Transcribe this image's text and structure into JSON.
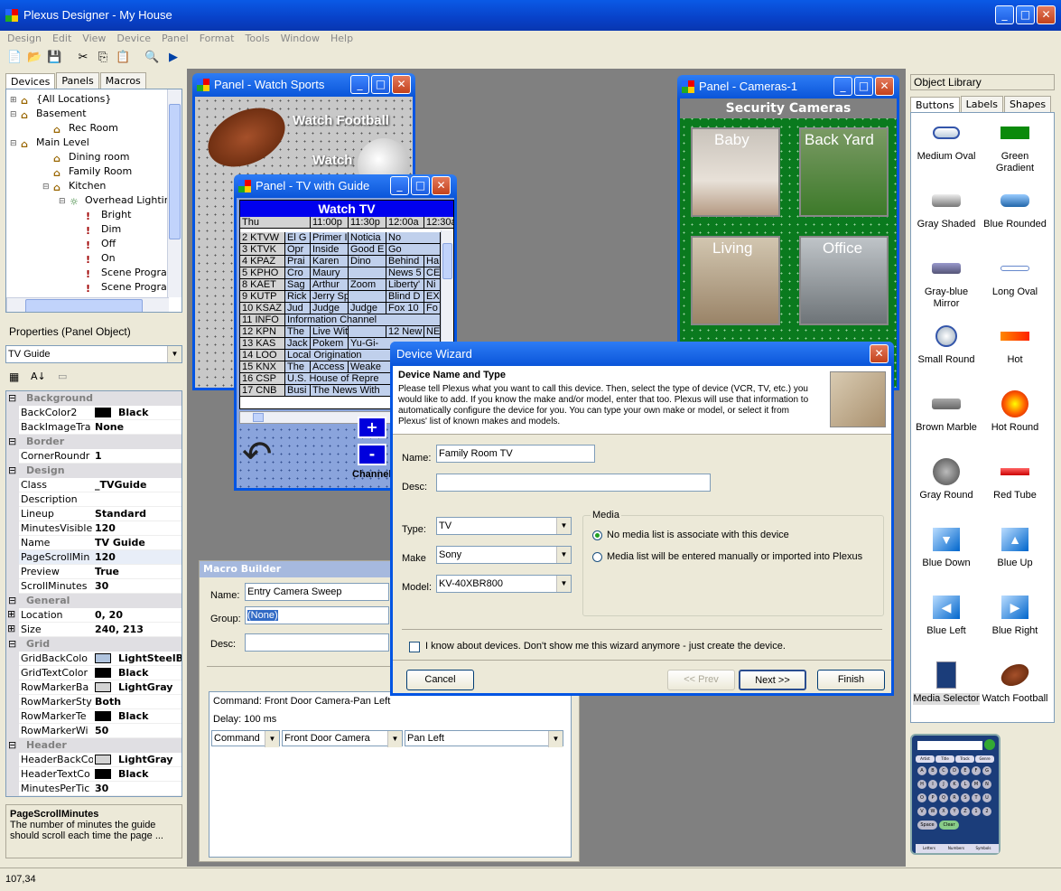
{
  "app": {
    "title": "Plexus Designer - My House"
  },
  "menu": [
    "Design",
    "Edit",
    "View",
    "Device",
    "Panel",
    "Format",
    "Tools",
    "Window",
    "Help"
  ],
  "left_tabs": [
    "Devices",
    "Panels",
    "Macros"
  ],
  "tree": [
    {
      "label": "{All Locations}",
      "depth": 0,
      "icon": "house-icon"
    },
    {
      "label": "Basement",
      "depth": 0,
      "icon": "house-icon"
    },
    {
      "label": "Rec Room",
      "depth": 1,
      "icon": "house-icon"
    },
    {
      "label": "Main Level",
      "depth": 0,
      "icon": "house-icon"
    },
    {
      "label": "Dining room",
      "depth": 1,
      "icon": "house-icon"
    },
    {
      "label": "Family Room",
      "depth": 1,
      "icon": "house-icon"
    },
    {
      "label": "Kitchen",
      "depth": 1,
      "icon": "house-icon"
    },
    {
      "label": "Overhead Lighting",
      "depth": 2,
      "icon": "lamp-icon"
    },
    {
      "label": "Bright",
      "depth": 3,
      "icon": "exclaim-icon"
    },
    {
      "label": "Dim",
      "depth": 3,
      "icon": "exclaim-icon"
    },
    {
      "label": "Off",
      "depth": 3,
      "icon": "exclaim-icon"
    },
    {
      "label": "On",
      "depth": 3,
      "icon": "exclaim-icon"
    },
    {
      "label": "Scene Program",
      "depth": 3,
      "icon": "exclaim-icon"
    },
    {
      "label": "Scene Program",
      "depth": 3,
      "icon": "exclaim-icon"
    }
  ],
  "properties": {
    "header": "Properties (Panel Object)",
    "object": "TV Guide",
    "rows": [
      {
        "cat": "Background"
      },
      {
        "name": "BackColor2",
        "value": "Black",
        "swatch": "#000000"
      },
      {
        "name": "BackImageTra",
        "value": "None"
      },
      {
        "cat": "Border"
      },
      {
        "name": "CornerRoundr",
        "value": "1"
      },
      {
        "cat": "Design"
      },
      {
        "name": "Class",
        "value": "_TVGuide"
      },
      {
        "name": "Description",
        "value": ""
      },
      {
        "name": "Lineup",
        "value": "Standard"
      },
      {
        "name": "MinutesVisible",
        "value": "120"
      },
      {
        "name": "Name",
        "value": "TV Guide"
      },
      {
        "name": "PageScrollMin",
        "value": "120"
      },
      {
        "name": "Preview",
        "value": "True"
      },
      {
        "name": "ScrollMinutes",
        "value": "30"
      },
      {
        "cat": "General"
      },
      {
        "name": "Location",
        "value": "0, 20"
      },
      {
        "name": "Size",
        "value": "240, 213"
      },
      {
        "cat": "Grid"
      },
      {
        "name": "GridBackColo",
        "value": "LightSteelBlue",
        "swatch": "#b0c4de"
      },
      {
        "name": "GridTextColor",
        "value": "Black",
        "swatch": "#000000"
      },
      {
        "name": "RowMarkerBa",
        "value": "LightGray",
        "swatch": "#d3d3d3"
      },
      {
        "name": "RowMarkerSty",
        "value": "Both"
      },
      {
        "name": "RowMarkerTe",
        "value": "Black",
        "swatch": "#000000"
      },
      {
        "name": "RowMarkerWi",
        "value": "50"
      },
      {
        "cat": "Header"
      },
      {
        "name": "HeaderBackCo",
        "value": "LightGray",
        "swatch": "#d3d3d3"
      },
      {
        "name": "HeaderTextCo",
        "value": "Black",
        "swatch": "#000000"
      },
      {
        "name": "MinutesPerTic",
        "value": "30"
      }
    ],
    "help_title": "PageScrollMinutes",
    "help_text": "The number of minutes the guide should scroll each time the page ..."
  },
  "panel_sports": {
    "title": "Panel - Watch Sports",
    "label1": "Watch Football",
    "label2": "Watch"
  },
  "panel_tv": {
    "title": "Panel - TV with Guide",
    "header": "Watch TV",
    "times": [
      "Thu",
      "11:00p",
      "11:30p",
      "12:00a",
      "12:30a"
    ],
    "rows": [
      [
        "2 KTVW",
        "El G",
        "Primer Impacto",
        "Noticia",
        "No"
      ],
      [
        "3 KTVK",
        "Opr",
        "Inside",
        "Good E",
        "Go"
      ],
      [
        "4 KPAZ",
        "Prai",
        "Karen",
        "Dino",
        "Behind",
        "Ha"
      ],
      [
        "5 KPHO",
        "Cro",
        "Maury",
        "",
        "News 5",
        "CE"
      ],
      [
        "8 KAET",
        "Sag",
        "Arthur",
        "Zoom",
        "Liberty'",
        "Ni"
      ],
      [
        "9 KUTP",
        "Rick",
        "Jerry Springer",
        "",
        "Blind D",
        "EX"
      ],
      [
        "10 KSAZ",
        "Jud",
        "Judge",
        "Judge",
        "Fox 10",
        "Fo"
      ],
      [
        "11 INFO",
        "Information Channel"
      ],
      [
        "12 KPN",
        "The",
        "Live With Regis",
        "",
        "12 New",
        "NE"
      ],
      [
        "13 KAS",
        "Jack",
        "Pokem",
        "Yu-Gi-"
      ],
      [
        "14 LOO",
        "Local Origination"
      ],
      [
        "15 KNX",
        "The",
        "Access",
        "Weake"
      ],
      [
        "16 CSP",
        "U.S. House of Repre"
      ],
      [
        "17 CNB",
        "Busi",
        "The News With"
      ]
    ],
    "plus": "+",
    "minus": "-",
    "channel": "Channel"
  },
  "panel_cameras": {
    "title": "Panel - Cameras-1",
    "header": "Security Cameras",
    "cams": [
      "Baby",
      "Back Yard",
      "Living",
      "Office"
    ]
  },
  "macro": {
    "title": "Macro Builder",
    "name_label": "Name:",
    "name_value": "Entry Camera Sweep",
    "group_label": "Group:",
    "group_value": "(None)",
    "desc_label": "Desc:",
    "command_text": "Command: Front Door Camera-Pan Left",
    "delay_text": "Delay: 100 ms",
    "sel1": "Command",
    "sel2": "Front Door Camera",
    "sel3": "Pan Left"
  },
  "wizard": {
    "title": "Device Wizard",
    "heading": "Device Name and Type",
    "desc": "Please tell Plexus what you want to call this device. Then, select the type of device (VCR, TV, etc.) you would like to add. If you know the make and/or model, enter that too. Plexus will use that information to automatically configure the device for you. You can type your own make or model, or select it from Plexus' list of known makes and models.",
    "name_label": "Name:",
    "name_value": "Family Room TV",
    "desc_label": "Desc:",
    "type_label": "Type:",
    "type_value": "TV",
    "make_label": "Make",
    "make_value": "Sony",
    "model_label": "Model:",
    "model_value": "KV-40XBR800",
    "media_title": "Media",
    "radio1": "No media list is associate with this device",
    "radio2": "Media list will be entered manually or imported into Plexus",
    "checkbox": "I know about devices. Don't show me this wizard anymore - just create the device.",
    "cancel": "Cancel",
    "prev": "<< Prev",
    "next": "Next >>",
    "finish": "Finish"
  },
  "library": {
    "header": "Object Library",
    "tabs": [
      "Buttons",
      "Labels",
      "Shapes"
    ],
    "items": [
      {
        "label": "Medium Oval",
        "icon": "oval-icon"
      },
      {
        "label": "Green Gradient",
        "icon": "green-rect-icon"
      },
      {
        "label": "Gray Shaded",
        "icon": "gray-shaded-icon"
      },
      {
        "label": "Blue Rounded",
        "icon": "blue-rounded-icon"
      },
      {
        "label": "Gray-blue Mirror",
        "icon": "mirror-icon"
      },
      {
        "label": "Long Oval",
        "icon": "long-oval-icon"
      },
      {
        "label": "Small Round",
        "icon": "small-round-icon"
      },
      {
        "label": "Hot",
        "icon": "hot-icon"
      },
      {
        "label": "Brown Marble",
        "icon": "marble-icon"
      },
      {
        "label": "Hot Round",
        "icon": "hot-round-icon"
      },
      {
        "label": "Gray Round",
        "icon": "gray-round-icon"
      },
      {
        "label": "Red Tube",
        "icon": "red-tube-icon"
      },
      {
        "label": "Blue Down",
        "icon": "blue-down-icon"
      },
      {
        "label": "Blue Up",
        "icon": "blue-up-icon"
      },
      {
        "label": "Blue Left",
        "icon": "blue-left-icon"
      },
      {
        "label": "Blue Right",
        "icon": "blue-right-icon"
      },
      {
        "label": "Media Selector",
        "icon": "media-selector-icon"
      },
      {
        "label": "Watch Football",
        "icon": "football-icon"
      }
    ],
    "preview_keys": [
      "Artist",
      "Title",
      "Track",
      "Genre"
    ],
    "preview_letters": [
      "A",
      "B",
      "C",
      "D",
      "E",
      "F",
      "G",
      "H",
      "I",
      "J",
      "K",
      "L",
      "M",
      "N",
      "O",
      "P",
      "Q",
      "R",
      "S",
      "T",
      "U",
      "V",
      "W",
      "X",
      "Y",
      "Z",
      "1",
      "2",
      "Space",
      "Clear"
    ],
    "preview_tabs": [
      "Letters",
      "Numbers",
      "Symbols"
    ]
  },
  "status": {
    "coords": "107,34"
  }
}
